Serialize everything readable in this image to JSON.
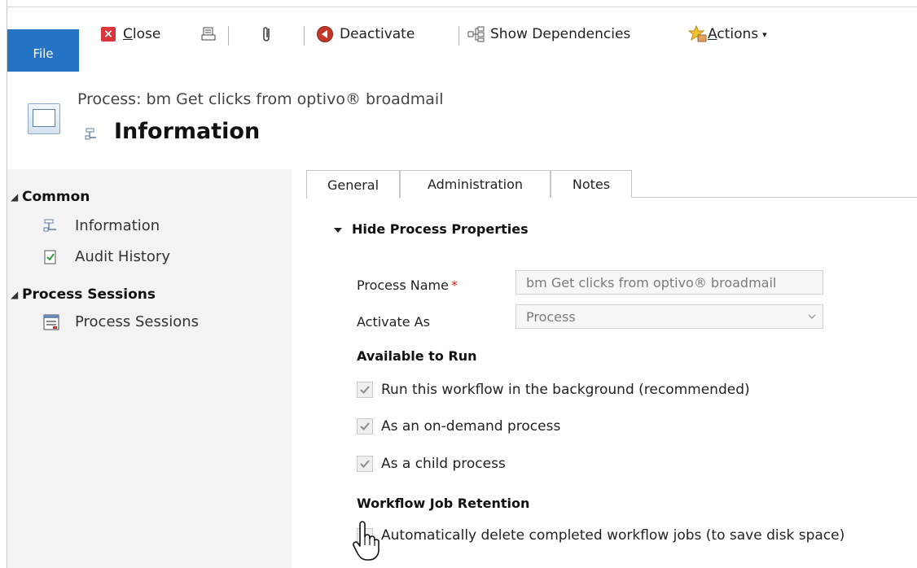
{
  "toolbar": {
    "file_label": "File",
    "close_label": "Close",
    "deactivate_label": "Deactivate",
    "show_dependencies_label": "Show Dependencies",
    "actions_label": "Actions"
  },
  "header": {
    "subtitle": "Process: bm Get clicks from optivo® broadmail",
    "title": "Information"
  },
  "nav": {
    "groups": [
      {
        "label": "Common",
        "items": [
          "Information",
          "Audit History"
        ]
      },
      {
        "label": "Process Sessions",
        "items": [
          "Process Sessions"
        ]
      }
    ]
  },
  "tabs": [
    "General",
    "Administration",
    "Notes"
  ],
  "section": {
    "title": "Hide Process Properties",
    "process_name_label": "Process Name",
    "process_name_value": "bm Get clicks from optivo® broadmail",
    "activate_as_label": "Activate As",
    "activate_as_value": "Process",
    "available_to_run_label": "Available to Run",
    "checkboxes": [
      {
        "label": "Run this workflow in the background (recommended)",
        "checked": true
      },
      {
        "label": "As an on-demand process",
        "checked": true
      },
      {
        "label": "As a child process",
        "checked": true
      }
    ],
    "retention_label": "Workflow Job Retention",
    "retention_checkbox": {
      "label": "Automatically delete completed workflow jobs (to save disk space)",
      "checked": false
    }
  },
  "colors": {
    "file_tab": "#2473c4",
    "nav_bg": "#f3f3f3",
    "required": "#e02020"
  }
}
